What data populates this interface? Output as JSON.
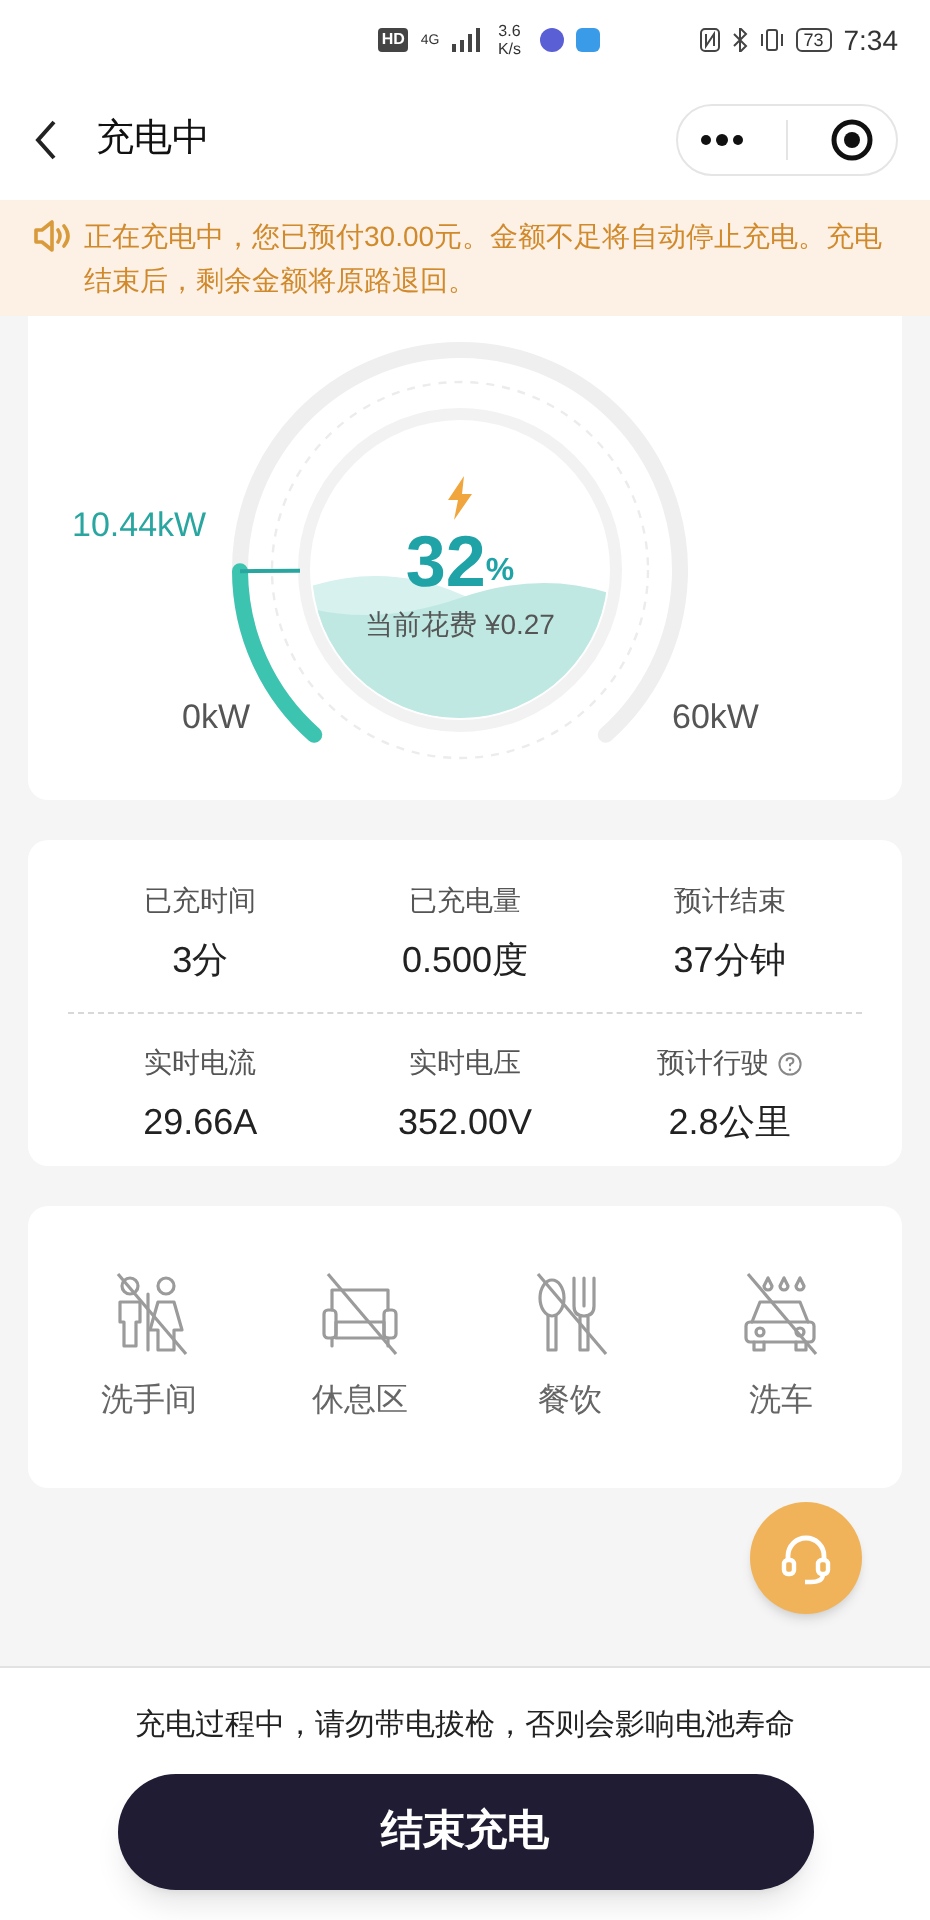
{
  "status_bar": {
    "hd": "HD",
    "network": "4G",
    "speed": "3.6 K/s",
    "battery": "73",
    "time": "7:34"
  },
  "nav": {
    "title": "充电中"
  },
  "notice": "正在充电中，您已预付30.00元。金额不足将自动停止充电。充电结束后，剩余金额将原路退回。",
  "gauge": {
    "power": "10.44kW",
    "min": "0kW",
    "max": "60kW",
    "percent": "32",
    "percent_unit": "%",
    "cost": "当前花费 ¥0.27"
  },
  "stats": [
    {
      "label": "已充时间",
      "value": "3分",
      "help": false
    },
    {
      "label": "已充电量",
      "value": "0.500度",
      "help": false
    },
    {
      "label": "预计结束",
      "value": "37分钟",
      "help": false
    },
    {
      "label": "实时电流",
      "value": "29.66A",
      "help": false
    },
    {
      "label": "实时电压",
      "value": "352.00V",
      "help": false
    },
    {
      "label": "预计行驶",
      "value": "2.8公里",
      "help": true
    }
  ],
  "facilities": [
    {
      "label": "洗手间",
      "kind": "restroom",
      "available": false
    },
    {
      "label": "休息区",
      "kind": "lounge",
      "available": false
    },
    {
      "label": "餐饮",
      "kind": "dining",
      "available": false
    },
    {
      "label": "洗车",
      "kind": "carwash",
      "available": false
    }
  ],
  "footer": {
    "warning": "充电过程中，请勿带电拔枪，否则会影响电池寿命",
    "button": "结束充电"
  }
}
